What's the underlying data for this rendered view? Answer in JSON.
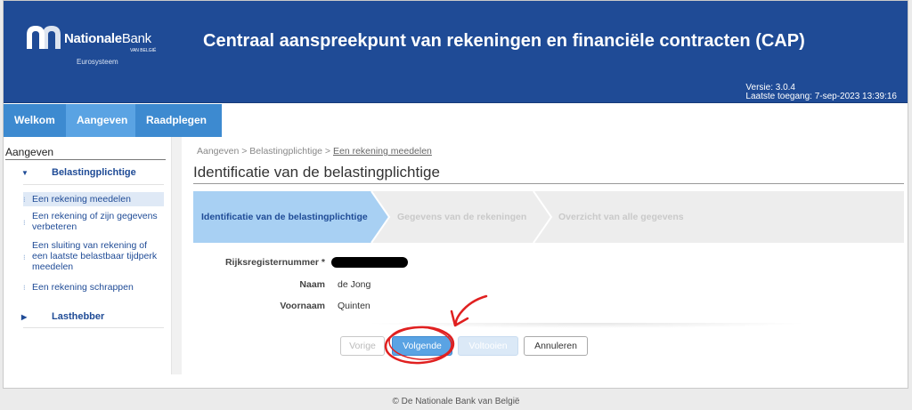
{
  "header": {
    "logo_name_bold": "Nationale",
    "logo_name_thin": "Bank",
    "logo_sub": "VAN BELGIË",
    "logo_euro": "Eurosysteem",
    "title": "Centraal aanspreekpunt van rekeningen en financiële contracten (CAP)",
    "version": "Versie: 3.0.4",
    "last_access": "Laatste toegang: 7-sep-2023 13:39:16"
  },
  "nav": {
    "tabs": [
      {
        "label": "Welkom"
      },
      {
        "label": "Aangeven"
      },
      {
        "label": "Raadplegen"
      }
    ]
  },
  "sidebar": {
    "heading": "Aangeven",
    "group_belasting": "Belastingplichtige",
    "items": [
      {
        "label": "Een rekening meedelen"
      },
      {
        "label": "Een rekening of zijn gegevens verbeteren"
      },
      {
        "label": "Een sluiting van rekening of een laatste belastbaar tijdperk meedelen"
      },
      {
        "label": "Een rekening schrappen"
      }
    ],
    "group_last": "Lasthebber"
  },
  "breadcrumb": {
    "item1": "Aangeven",
    "sep": ">",
    "item2": "Belastingplichtige",
    "item3": "Een rekening meedelen"
  },
  "page_title": "Identificatie van de belastingplichtige",
  "steps": [
    {
      "label": "Identificatie van de belastingplichtige",
      "state": "active"
    },
    {
      "label": "Gegevens van de rekeningen",
      "state": "inactive"
    },
    {
      "label": "Overzicht van alle gegevens",
      "state": "inactive"
    }
  ],
  "form": {
    "rrn_label": "Rijksregisternummer *",
    "naam_label": "Naam",
    "naam_value": "de Jong",
    "voornaam_label": "Voornaam",
    "voornaam_value": "Quinten"
  },
  "buttons": {
    "prev": "Vorige",
    "next": "Volgende",
    "finish": "Voltooien",
    "cancel": "Annuleren"
  },
  "colors": {
    "header": "#1f4b96",
    "nav": "#3d8ad0",
    "active_step": "#a8d0f3",
    "annotation": "#e02020"
  },
  "footer": "© De Nationale Bank van België"
}
